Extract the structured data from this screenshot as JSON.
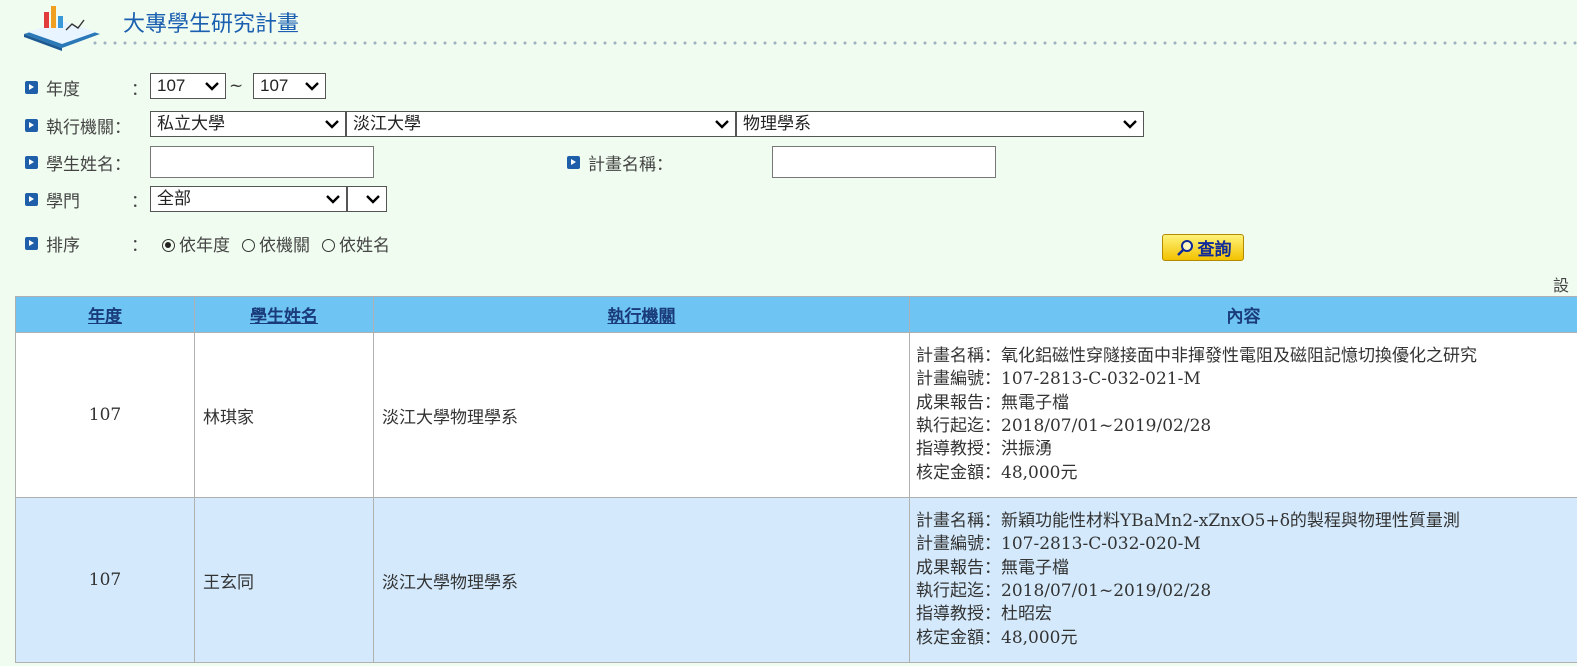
{
  "page": {
    "title": "大專學生研究計畫",
    "cut_text": "設"
  },
  "filters": {
    "year": {
      "label": "年度",
      "colon": "：",
      "from": "107",
      "separator": "~",
      "to": "107"
    },
    "org": {
      "label": "執行機關",
      "colon": "：",
      "type": "私立大學",
      "school": "淡江大學",
      "dept": "物理學系"
    },
    "student": {
      "label": "學生姓名",
      "colon": "：",
      "value": ""
    },
    "plan": {
      "label": "計畫名稱",
      "colon": "：",
      "value": ""
    },
    "field": {
      "label": "學門",
      "colon": "：",
      "value": "全部",
      "sub": ""
    },
    "sort": {
      "label": "排序",
      "colon": "：",
      "options": [
        "依年度",
        "依機關",
        "依姓名"
      ],
      "selected": "依年度"
    },
    "search_button": "查詢"
  },
  "table": {
    "headers": [
      "年度",
      "學生姓名",
      "執行機關",
      "內容"
    ],
    "rows": [
      {
        "year": "107",
        "name": "林琪家",
        "org": "淡江大學物理學系",
        "content": [
          "計畫名稱：氧化鋁磁性穿隧接面中非揮發性電阻及磁阻記憶切換優化之研究",
          "計畫編號：107-2813-C-032-021-M",
          "成果報告：無電子檔",
          "執行起迄：2018/07/01~2019/02/28",
          "指導教授：洪振湧",
          "核定金額：48,000元"
        ]
      },
      {
        "year": "107",
        "name": "王玄同",
        "org": "淡江大學物理學系",
        "content": [
          "計畫名稱：新穎功能性材料YBaMn2-xZnxO5+δ的製程與物理性質量測",
          "計畫編號：107-2813-C-032-020-M",
          "成果報告：無電子檔",
          "執行起迄：2018/07/01~2019/02/28",
          "指導教授：杜昭宏",
          "核定金額：48,000元"
        ]
      }
    ]
  },
  "colors": {
    "header_bg": "#6ec4f2",
    "alt_row": "#d4eafc",
    "page_bg": "#f0fcf0",
    "title": "#1a5fb0"
  }
}
